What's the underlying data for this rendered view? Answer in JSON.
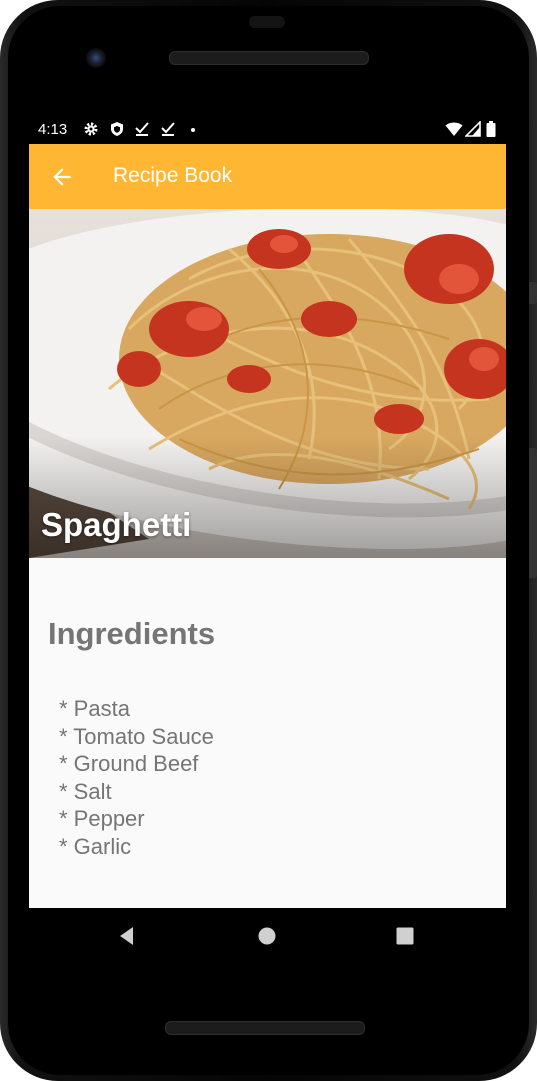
{
  "status_bar": {
    "time": "4:13",
    "left_icons": [
      "settings-icon",
      "shield-icon",
      "download-done-icon",
      "download-done-icon",
      "dot-icon"
    ],
    "right_icons": [
      "wifi-icon",
      "signal-icon",
      "battery-icon"
    ]
  },
  "app_bar": {
    "title": "Recipe Book",
    "back_icon": "arrow-back-icon",
    "color": "#FFB733"
  },
  "recipe": {
    "name": "Spaghetti",
    "image": "spaghetti-photo"
  },
  "ingredients": {
    "heading": "Ingredients",
    "items": [
      "* Pasta",
      "* Tomato Sauce",
      "* Ground Beef",
      "* Salt",
      "* Pepper",
      "* Garlic"
    ]
  },
  "nav_bar": {
    "buttons": [
      "back-triangle-icon",
      "home-circle-icon",
      "recents-square-icon"
    ]
  }
}
